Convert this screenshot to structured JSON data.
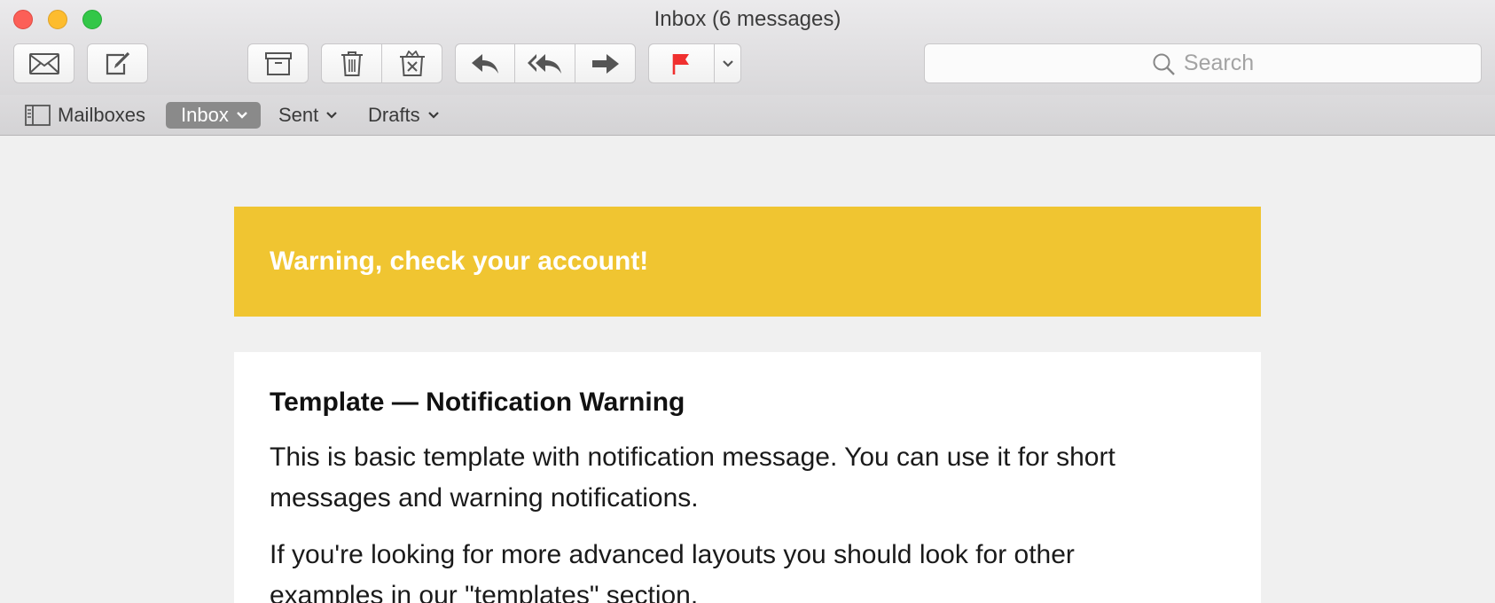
{
  "window": {
    "title": "Inbox (6 messages)"
  },
  "toolbar": {
    "buttons": [
      {
        "name": "get-mail",
        "icon": "envelope-icon"
      },
      {
        "name": "compose",
        "icon": "compose-icon"
      },
      {
        "name": "archive",
        "icon": "archive-icon"
      },
      {
        "name": "delete",
        "icon": "trash-icon"
      },
      {
        "name": "junk",
        "icon": "junk-icon"
      },
      {
        "name": "reply",
        "icon": "reply-icon"
      },
      {
        "name": "reply-all",
        "icon": "reply-all-icon"
      },
      {
        "name": "forward",
        "icon": "forward-icon"
      },
      {
        "name": "flag",
        "icon": "flag-icon"
      },
      {
        "name": "flag-menu",
        "icon": "chevron-down-icon"
      }
    ],
    "flag_color": "#f0302f"
  },
  "search": {
    "placeholder": "Search"
  },
  "favorites": {
    "mailboxes": "Mailboxes",
    "inbox": "Inbox",
    "sent": "Sent",
    "drafts": "Drafts"
  },
  "message": {
    "banner": "Warning, check your account!",
    "banner_color": "#f0c531",
    "heading": "Template — Notification Warning",
    "paragraph1": "This is basic template with notification message. You can use it for short messages and warning notifications.",
    "paragraph2": "If you're looking for more advanced layouts you should look for other examples in our \"templates\" section."
  }
}
